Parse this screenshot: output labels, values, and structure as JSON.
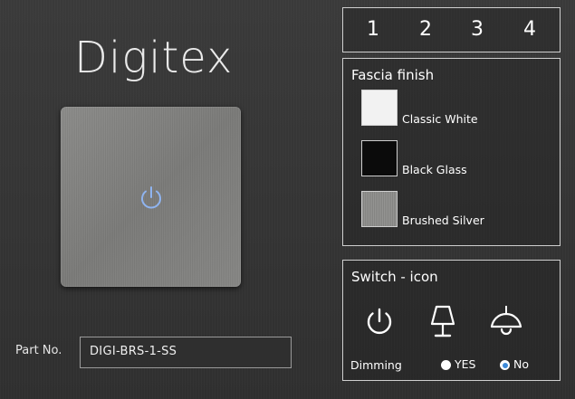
{
  "brand": {
    "title": "Digitex"
  },
  "part": {
    "label": "Part No.",
    "value": "DIGI-BRS-1-SS"
  },
  "tabs": [
    "1",
    "2",
    "3",
    "4"
  ],
  "finish": {
    "title": "Fascia finish",
    "options": [
      {
        "label": "Classic White",
        "color": "#f2f2f2"
      },
      {
        "label": "Black Glass",
        "color": "#0b0b0b"
      },
      {
        "label": "Brushed Silver",
        "color": "#8b8b89"
      }
    ]
  },
  "switch": {
    "title": "Switch - icon",
    "icons": [
      "power-icon",
      "table-lamp-icon",
      "pendant-lamp-icon"
    ],
    "dimming": {
      "label": "Dimming",
      "yes_label": "YES",
      "no_label": "No",
      "selected": "No"
    }
  },
  "colors": {
    "accent": "#3d8ad9",
    "power_glow": "#8fb4f0"
  }
}
